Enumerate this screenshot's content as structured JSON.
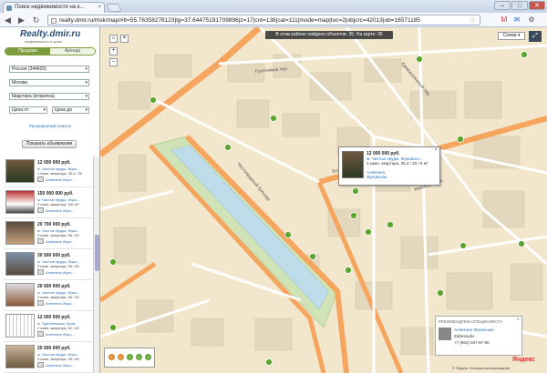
{
  "browser": {
    "tab_title": "Поиск недвижимости на к...",
    "tab_close": "×",
    "url": "realty.dmir.ru/msk/map/#lt=55.76358278123|lg=37.64475191709896|z=17|cnt=138|cat=111|mode=map|toc=2|objcrc=42013|ob=16571185",
    "back": "◀",
    "forward": "▶",
    "reload": "↻",
    "minimize": "–",
    "maximize": "□",
    "close": "✕",
    "star": "☆",
    "ext_icons": [
      "M",
      "✉",
      "⚙"
    ]
  },
  "sidebar": {
    "logo": "Realty.dmir.ru",
    "slogan": "недвижимость и цены",
    "deal_tabs": [
      "Продажа",
      "Аренда"
    ],
    "selects": {
      "region": "Россия (344603)",
      "city": "Москва",
      "type": "Квартира (вторичка)",
      "price_from": "Цена от",
      "price_to": "Цена до"
    },
    "extended_search": "Расширенный поиск ▸",
    "show_button": "Показать объявления",
    "listings": [
      {
        "price": "12 000 000 руб.",
        "addr": "м. Чистые пруды, Жуко...",
        "desc": "1 комн. квартира, 35,4 / 20",
        "agent": "Алевтина Жуко..."
      },
      {
        "price": "150 000 000 руб.",
        "addr": "м. Чистые пруды, Жуко...",
        "desc": "5 комн. квартира, 341 м²",
        "agent": "Алевтина Жуко..."
      },
      {
        "price": "20 700 000 руб.",
        "addr": "м. Чистые пруды, Жуко...",
        "desc": "3 комн. квартира, 68 / 52",
        "agent": "Алевтина Жуко..."
      },
      {
        "price": "20 500 000 руб.",
        "addr": "м. Чистые пруды, Жуко...",
        "desc": "3 комн. квартира, 95 / 50",
        "agent": "Алевтина Жуко..."
      },
      {
        "price": "20 500 000 руб.",
        "addr": "м. Чистые пруды, Жуко...",
        "desc": "3 комн. квартира, 95 / 50",
        "agent": "Алевтина Жуко..."
      },
      {
        "price": "12 000 000 руб.",
        "addr": "м. Тургеневская, Крив...",
        "desc": "2 комн. квартира, 52 / 40",
        "agent": "Алевтина Жуко..."
      },
      {
        "price": "20 500 000 руб.",
        "addr": "м. Чистые пруды, Жуко...",
        "desc": "3 комн. квартира, 95 / 50",
        "agent": "Алевтина Жуко..."
      }
    ]
  },
  "map": {
    "banner": "В этом районе найдено объектов: 35. На карте: 35",
    "scheme_label": "Схема ▾",
    "fullscreen": "⤢",
    "zoom_in": "+",
    "zoom_out": "–",
    "popup": {
      "price": "12 000 000 руб.",
      "addr": "м. Чистые пруды, Жуковско...",
      "desc": "1 комн. квартира, 35,4 / 20 / 6 м²",
      "agent": "Алевтина",
      "agent2": "Жуковская",
      "close": "×"
    },
    "recommend": {
      "title": "РЕКОМЕНДУЕМ СПЕЦИАЛИСТА",
      "name": "Алевтина Жуковская",
      "company": "Zafarstudio",
      "phone": "+7 (962) 937-87-56",
      "close": "×"
    },
    "yandex": "Яндекс",
    "copyright": "© Яндекс  Условия использования",
    "legend": [
      "1",
      "2",
      "3",
      "4",
      "5"
    ],
    "street_labels": [
      "Чистопрудный бульвар",
      "Большой Харитоньевский пер.",
      "Гусятников пер.",
      "Кривоколенный пер.",
      "Мясницкая ул."
    ],
    "pin_color": "#5ea52f",
    "road_color": "#f6a55f"
  }
}
